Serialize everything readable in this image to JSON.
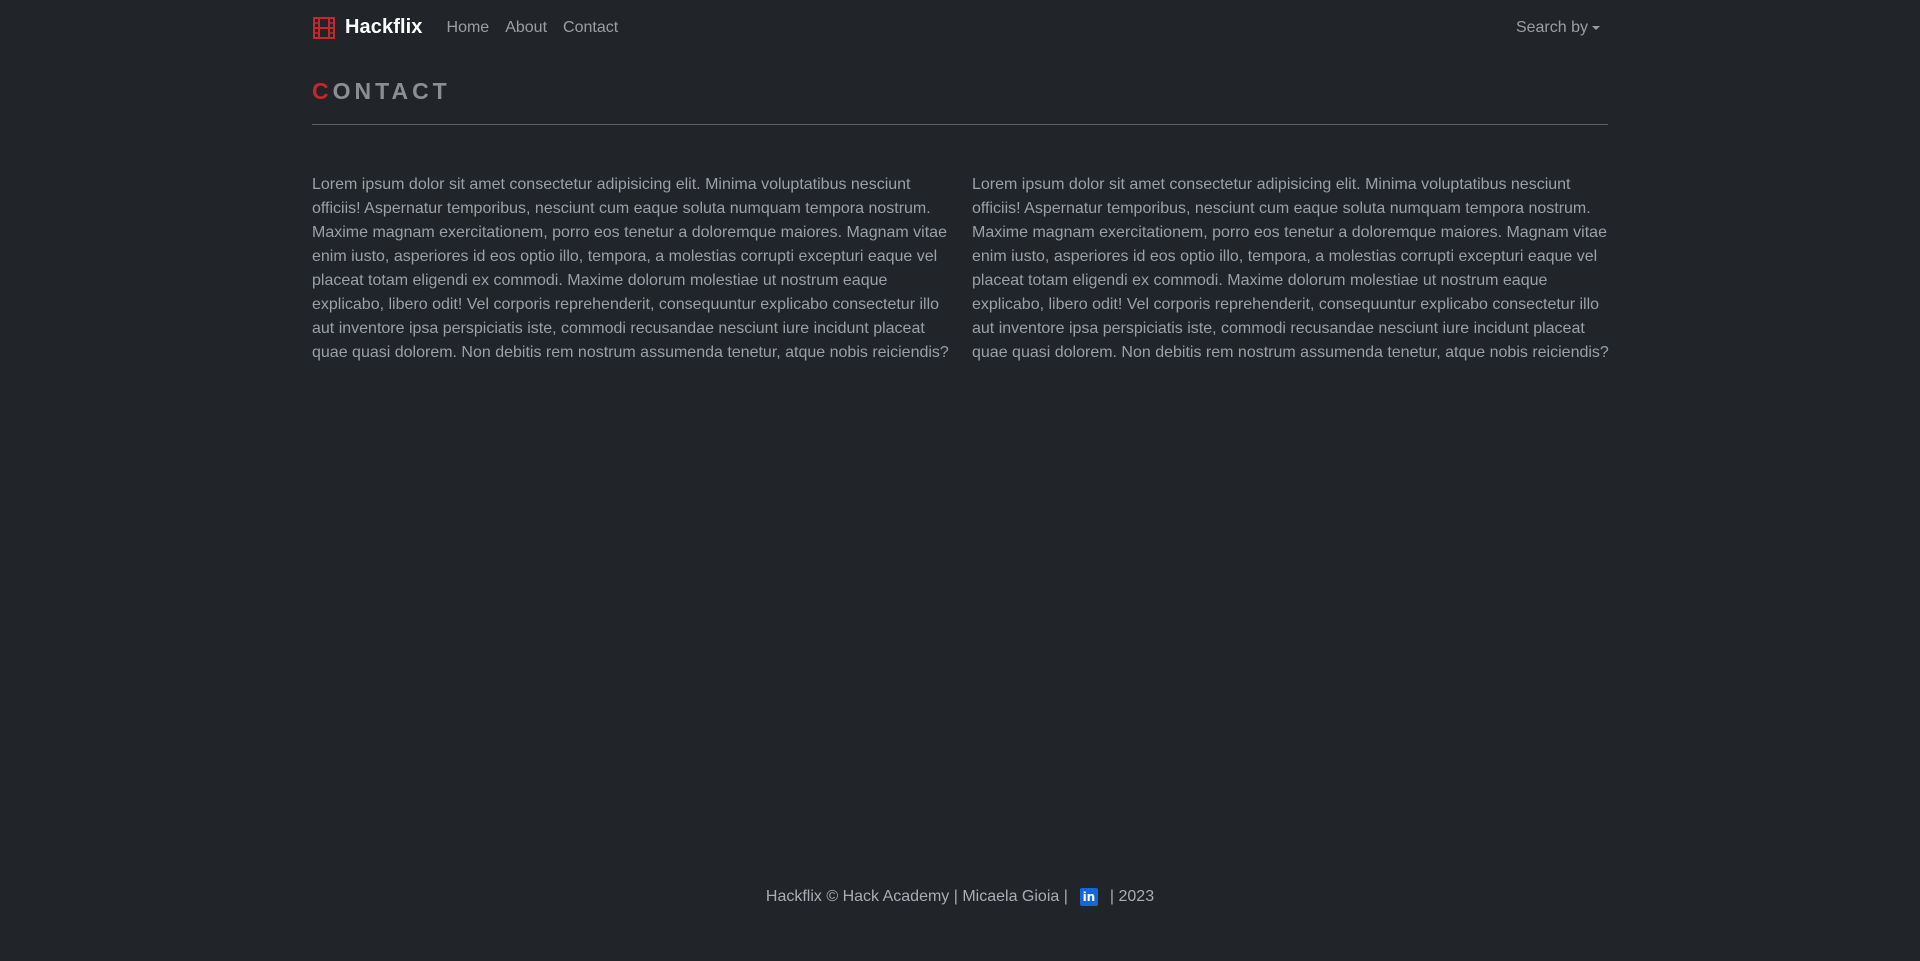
{
  "navbar": {
    "brand": "Hackflix",
    "links": [
      "Home",
      "About",
      "Contact"
    ],
    "dropdown_label": "Search by",
    "brand_icon": "film-icon",
    "accent_color": "#c8262e"
  },
  "main": {
    "heading_first": "C",
    "heading_rest": "ONTACT",
    "paragraphs": [
      "Lorem ipsum dolor sit amet consectetur adipisicing elit. Minima voluptatibus nesciunt officiis! Aspernatur temporibus, nesciunt cum eaque soluta numquam tempora nostrum. Maxime magnam exercitationem, porro eos tenetur a doloremque maiores. Magnam vitae enim iusto, asperiores id eos optio illo, tempora, a molestias corrupti excepturi eaque vel placeat totam eligendi ex commodi. Maxime dolorum molestiae ut nostrum eaque explicabo, libero odit! Vel corporis reprehenderit, consequuntur explicabo consectetur illo aut inventore ipsa perspiciatis iste, commodi recusandae nesciunt iure incidunt placeat quae quasi dolorem. Non debitis rem nostrum assumenda tenetur, atque nobis reiciendis?",
      "Lorem ipsum dolor sit amet consectetur adipisicing elit. Minima voluptatibus nesciunt officiis! Aspernatur temporibus, nesciunt cum eaque soluta numquam tempora nostrum. Maxime magnam exercitationem, porro eos tenetur a doloremque maiores. Magnam vitae enim iusto, asperiores id eos optio illo, tempora, a molestias corrupti excepturi eaque vel placeat totam eligendi ex commodi. Maxime dolorum molestiae ut nostrum eaque explicabo, libero odit! Vel corporis reprehenderit, consequuntur explicabo consectetur illo aut inventore ipsa perspiciatis iste, commodi recusandae nesciunt iure incidunt placeat quae quasi dolorem. Non debitis rem nostrum assumenda tenetur, atque nobis reiciendis?"
    ]
  },
  "footer": {
    "text_before": "Hackflix © Hack Academy | Micaela Gioia |",
    "linkedin_glyph": "in",
    "linkedin_icon": "linkedin-icon",
    "linkedin_color": "#1666d9",
    "text_after": "| 2023"
  }
}
